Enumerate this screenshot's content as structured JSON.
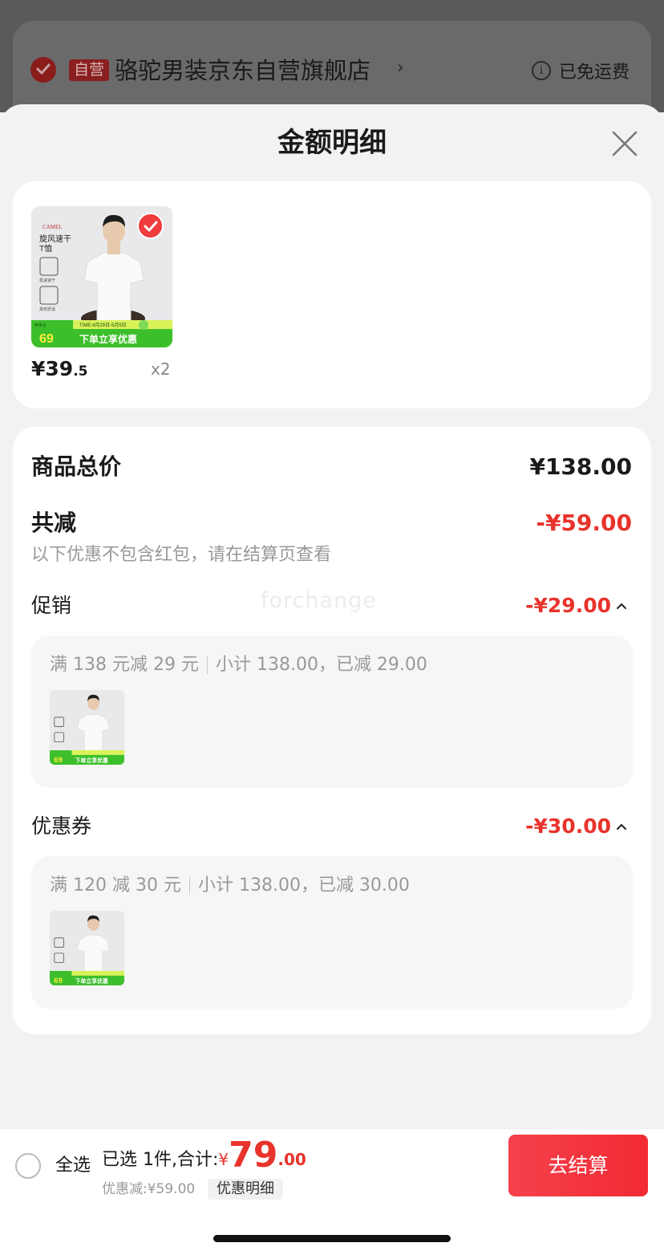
{
  "background_store": {
    "badge": "自营",
    "name": "骆驼男装京东自营旗舰店",
    "arrow": "›",
    "info_glyph": "i",
    "shipping": "已免运费"
  },
  "sheet": {
    "title": "金额明细"
  },
  "product": {
    "price_main": "¥39",
    "price_decimal": ".5",
    "quantity": "x2",
    "image": {
      "brand": "CAMEL",
      "line1": "旋风速干",
      "line2": "T恤",
      "feature1": "极速速干",
      "feature2": "柔软舒适",
      "price_tag_label": "到手价",
      "price_tag_value": "69",
      "promo_time": "TIME:4月29日-5月5日",
      "promo_text": "下单立享优惠"
    }
  },
  "detail": {
    "total_label": "商品总价",
    "total_value": "¥138.00",
    "discount_label": "共减",
    "discount_value": "-¥59.00",
    "discount_note": "以下优惠不包含红包，请在结算页查看",
    "promo": {
      "label": "促销",
      "value": "-¥29.00",
      "rule": "满 138 元减 29 元",
      "subtotal": "小计 138.00，已减 29.00"
    },
    "coupon": {
      "label": "优惠券",
      "value": "-¥30.00",
      "rule": "满 120 减 30 元",
      "subtotal": "小计 138.00，已减 30.00"
    },
    "watermark": "forchange"
  },
  "bottom_bar": {
    "select_all": "全选",
    "selected_text": "已选 1件,合计:",
    "currency": "¥",
    "total_integer": "79",
    "total_decimal": ".00",
    "discount_text": "优惠减:¥59.00",
    "discount_detail_button": "优惠明细",
    "checkout_button": "去结算"
  },
  "colors": {
    "accent_red": "#e8332b",
    "checkout_red": "#f22a33",
    "promo_green": "#3cbf2a"
  }
}
